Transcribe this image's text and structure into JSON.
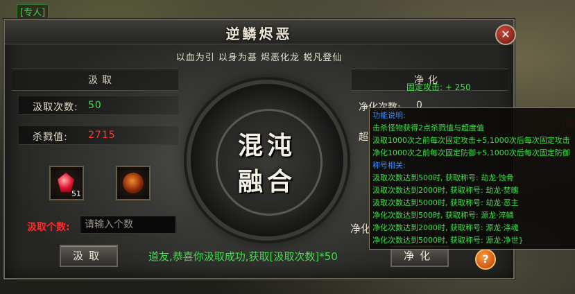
{
  "background": {
    "top_tag": "[专人]",
    "left_number": "50",
    "right_badge": "[励"
  },
  "window": {
    "title": "逆鳞烬恶",
    "close_label": "✕",
    "motto": "以血为引  以身为基  烬恶化龙  蜕凡登仙"
  },
  "left": {
    "header": "汲取",
    "draw_count_label": "汲取次数:",
    "draw_count_value": "50",
    "kill_label": "杀戮值:",
    "kill_value": "2715",
    "item1_count": "51",
    "input_label": "汲取个数:",
    "input_placeholder": "请输入个数",
    "button": "汲取"
  },
  "center": {
    "emblem_line1": "混沌",
    "emblem_line2": "融合",
    "message": "道友,恭喜你汲取成功,获取[汲取次数]*50"
  },
  "right": {
    "header": "净化",
    "purify_count_label": "净化次数:",
    "purify_count_value": "0",
    "superdegree_label": "超",
    "fixed_attack": "固定攻击: + 250",
    "purify_partial": "净化",
    "button": "净化",
    "help": "?"
  },
  "tooltip": {
    "lines": [
      "功能说明:",
      "击杀怪物获得2点杀戮值与超度值",
      "汲取1000次之前每次固定攻击+5,1000次后每次固定攻击",
      "净化1000次之前每次固定防御+5,1000次后每次固定防御",
      "称号相关:",
      "汲取次数达到500时, 获取称号: 劫龙·蚀骨",
      "汲取次数达到2000时, 获取称号: 劫龙·焚魄",
      "汲取次数达到5000时, 获取称号: 劫龙·恶主",
      "净化次数达到500时, 获取称号: 源龙·淬鳞",
      "净化次数达到2000时, 获取称号: 源龙·涤魂",
      "净化次数达到5000时, 获取称号: 源龙·净世}"
    ]
  },
  "colors": {
    "green": "#3ee04a",
    "red": "#ff3a2a",
    "tooltip_head": "#3a8cff"
  }
}
